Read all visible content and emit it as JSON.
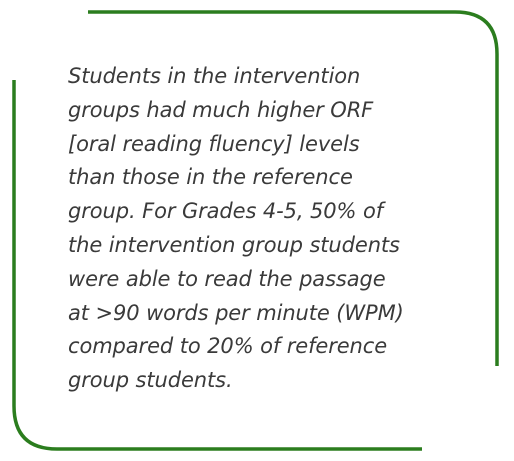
{
  "quote": {
    "lines": [
      "Students in the intervention",
      "groups had much higher ORF",
      "[oral reading fluency] levels",
      "than those in the reference",
      "group. For Grades 4-5, 50% of",
      "the intervention group students",
      "were able to read the passage",
      "at >90 words per minute (WPM)",
      "compared to 20% of reference",
      "group students."
    ]
  },
  "colors": {
    "frame": "#2b7d1e",
    "text": "#3a3a3a",
    "background": "#ffffff"
  }
}
